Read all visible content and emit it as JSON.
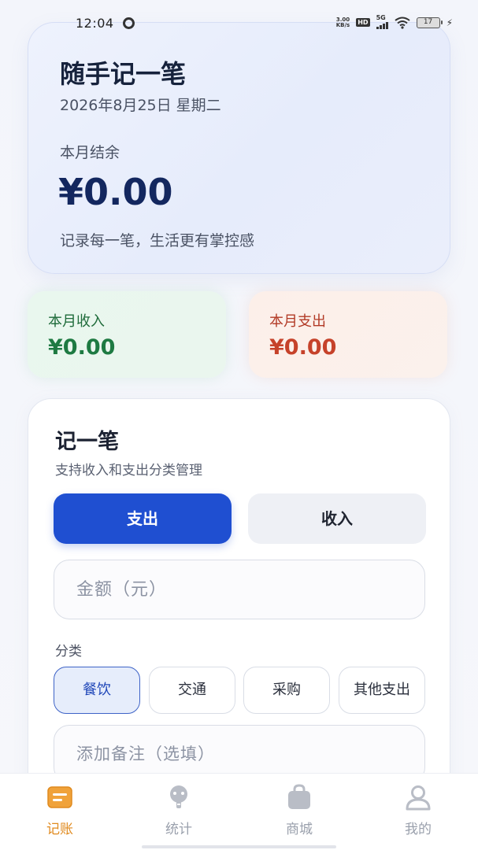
{
  "status_bar": {
    "time": "12:04",
    "net_speed_top": "3.00",
    "net_speed_bottom": "KB/s",
    "hd": "HD",
    "signal_label": "5G",
    "battery": "17"
  },
  "hero": {
    "title": "随手记一笔",
    "date": "2026年8月25日 星期二",
    "balance_label": "本月结余",
    "balance": "¥0.00",
    "slogan": "记录每一笔，生活更有掌控感"
  },
  "summary": {
    "income_label": "本月收入",
    "income_value": "¥0.00",
    "expense_label": "本月支出",
    "expense_value": "¥0.00"
  },
  "form": {
    "title": "记一笔",
    "subtitle": "支持收入和支出分类管理",
    "tab_expense": "支出",
    "tab_income": "收入",
    "selected_tab": "支出",
    "amount_placeholder": "金额（元）",
    "category_label": "分类",
    "categories": [
      "餐饮",
      "交通",
      "采购",
      "其他支出"
    ],
    "selected_category": "餐饮",
    "note_placeholder": "添加备注（选填）"
  },
  "nav": {
    "items": [
      {
        "label": "记账",
        "icon": "ledger-icon",
        "active": true
      },
      {
        "label": "统计",
        "icon": "stats-icon",
        "active": false
      },
      {
        "label": "商城",
        "icon": "shopping-bag-icon",
        "active": false
      },
      {
        "label": "我的",
        "icon": "user-icon",
        "active": false
      }
    ]
  },
  "colors": {
    "accent": "#1f4fd1",
    "nav_active": "#e08a1e",
    "income": "#1e7a42",
    "expense": "#c6422a"
  }
}
